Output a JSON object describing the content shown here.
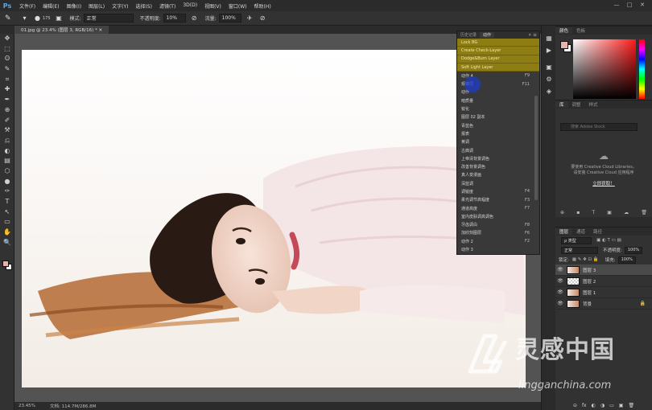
{
  "app": {
    "logo": "Ps"
  },
  "menu": [
    "文件(F)",
    "编辑(E)",
    "图像(I)",
    "图层(L)",
    "文字(Y)",
    "选择(S)",
    "滤镜(T)",
    "3D(D)",
    "视图(V)",
    "窗口(W)",
    "帮助(H)"
  ],
  "window_controls": [
    "—",
    "□",
    "✕"
  ],
  "options_bar": {
    "brush_size": "175",
    "mode_label": "模式:",
    "mode_value": "正常",
    "opacity_label": "不透明度:",
    "opacity_value": "10%",
    "flow_label": "流量:",
    "flow_value": "100%"
  },
  "document_tab": {
    "title": "01.jpg @ 23.4% (图层 3, RGB/16) * ✕"
  },
  "tools": [
    "✥",
    "⬚",
    "ʘ",
    "✎",
    "⌗",
    "✚",
    "✒",
    "⊕",
    "✐",
    "⚒",
    "⎌",
    "◐",
    "▤",
    "⬡",
    "●",
    "✑",
    "T",
    "↖",
    "▭",
    "✋",
    "🔍"
  ],
  "status": {
    "zoom": "23.45%",
    "doc": "文档: 114.7M/286.8M"
  },
  "actions_panel": {
    "tabs": [
      "历史记录",
      "动作"
    ],
    "active_tab": 1,
    "menu_icon": "»  ≡",
    "rows": [
      {
        "label": "Lock BG",
        "shortcut": "",
        "style": "gold"
      },
      {
        "label": "Create Check-Layer",
        "shortcut": "",
        "style": "gold"
      },
      {
        "label": "Dodge&Burn Layer",
        "shortcut": "",
        "style": "gold"
      },
      {
        "label": "Soft Light Layer",
        "shortcut": "",
        "style": "gold"
      },
      {
        "label": "动作 4",
        "shortcut": "F9",
        "style": ""
      },
      {
        "label": "观察层",
        "shortcut": "F11",
        "style": ""
      },
      {
        "label": "动作",
        "shortcut": "",
        "style": ""
      },
      {
        "label": "暗质量",
        "shortcut": "",
        "style": ""
      },
      {
        "label": "锐化",
        "shortcut": "",
        "style": ""
      },
      {
        "label": "图层 02 副本",
        "shortcut": "",
        "style": ""
      },
      {
        "label": "青蓝色",
        "shortcut": "",
        "style": ""
      },
      {
        "label": "报表",
        "shortcut": "",
        "style": ""
      },
      {
        "label": "黄调",
        "shortcut": "",
        "style": ""
      },
      {
        "label": "古典调",
        "shortcut": "",
        "style": ""
      },
      {
        "label": "上帝清背景调色",
        "shortcut": "",
        "style": ""
      },
      {
        "label": "改善背景调色",
        "shortcut": "",
        "style": ""
      },
      {
        "label": "真人变漫画",
        "shortcut": "",
        "style": ""
      },
      {
        "label": "深蓝调",
        "shortcut": "",
        "style": ""
      },
      {
        "label": "调锐度",
        "shortcut": "F4",
        "style": ""
      },
      {
        "label": "柔光调节高幅度",
        "shortcut": "F3",
        "style": ""
      },
      {
        "label": "通道高度",
        "shortcut": "F7",
        "style": ""
      },
      {
        "label": "室内皮肤调高调色",
        "shortcut": "",
        "style": ""
      },
      {
        "label": "牙齿调白",
        "shortcut": "F8",
        "style": ""
      },
      {
        "label": "加欣刻图层",
        "shortcut": "F6",
        "style": ""
      },
      {
        "label": "动作 2",
        "shortcut": "F2",
        "style": ""
      },
      {
        "label": "动作 3",
        "shortcut": "",
        "style": ""
      }
    ]
  },
  "dock_icons": [
    "▦",
    "▶",
    "▣",
    "⚙",
    "◈"
  ],
  "color_panel": {
    "tabs": [
      "颜色",
      "色板"
    ],
    "foreground": "#e9b3ad",
    "background": "#ffffff"
  },
  "library_panel": {
    "tabs": [
      "库",
      "调整",
      "样式"
    ],
    "search_placeholder": "搜索 Adobe Stock",
    "line1": "要使用 Creative Cloud Libraries，",
    "line2": "请安装 Creative Cloud 应用程序",
    "link": "立即获取！"
  },
  "layers_panel": {
    "tabs": [
      "图层",
      "通道",
      "路径"
    ],
    "kind_label": "ρ 类型",
    "blend_mode": "正常",
    "opacity_label": "不透明度:",
    "opacity_value": "100%",
    "lock_label": "锁定:",
    "fill_label": "填充:",
    "fill_value": "100%",
    "layers": [
      {
        "name": "图层 3",
        "selected": true,
        "thumb": "photo"
      },
      {
        "name": "图层 2",
        "selected": false,
        "thumb": "checker"
      },
      {
        "name": "图层 1",
        "selected": false,
        "thumb": "photo"
      },
      {
        "name": "背景",
        "selected": false,
        "thumb": "photo",
        "locked": true
      }
    ],
    "footer_icons": [
      "⊝",
      "fx",
      "◐",
      "◑",
      "▭",
      "▣",
      "🗑"
    ]
  },
  "watermark": {
    "cn": "灵感中国",
    "url": "lingganchina.com"
  }
}
